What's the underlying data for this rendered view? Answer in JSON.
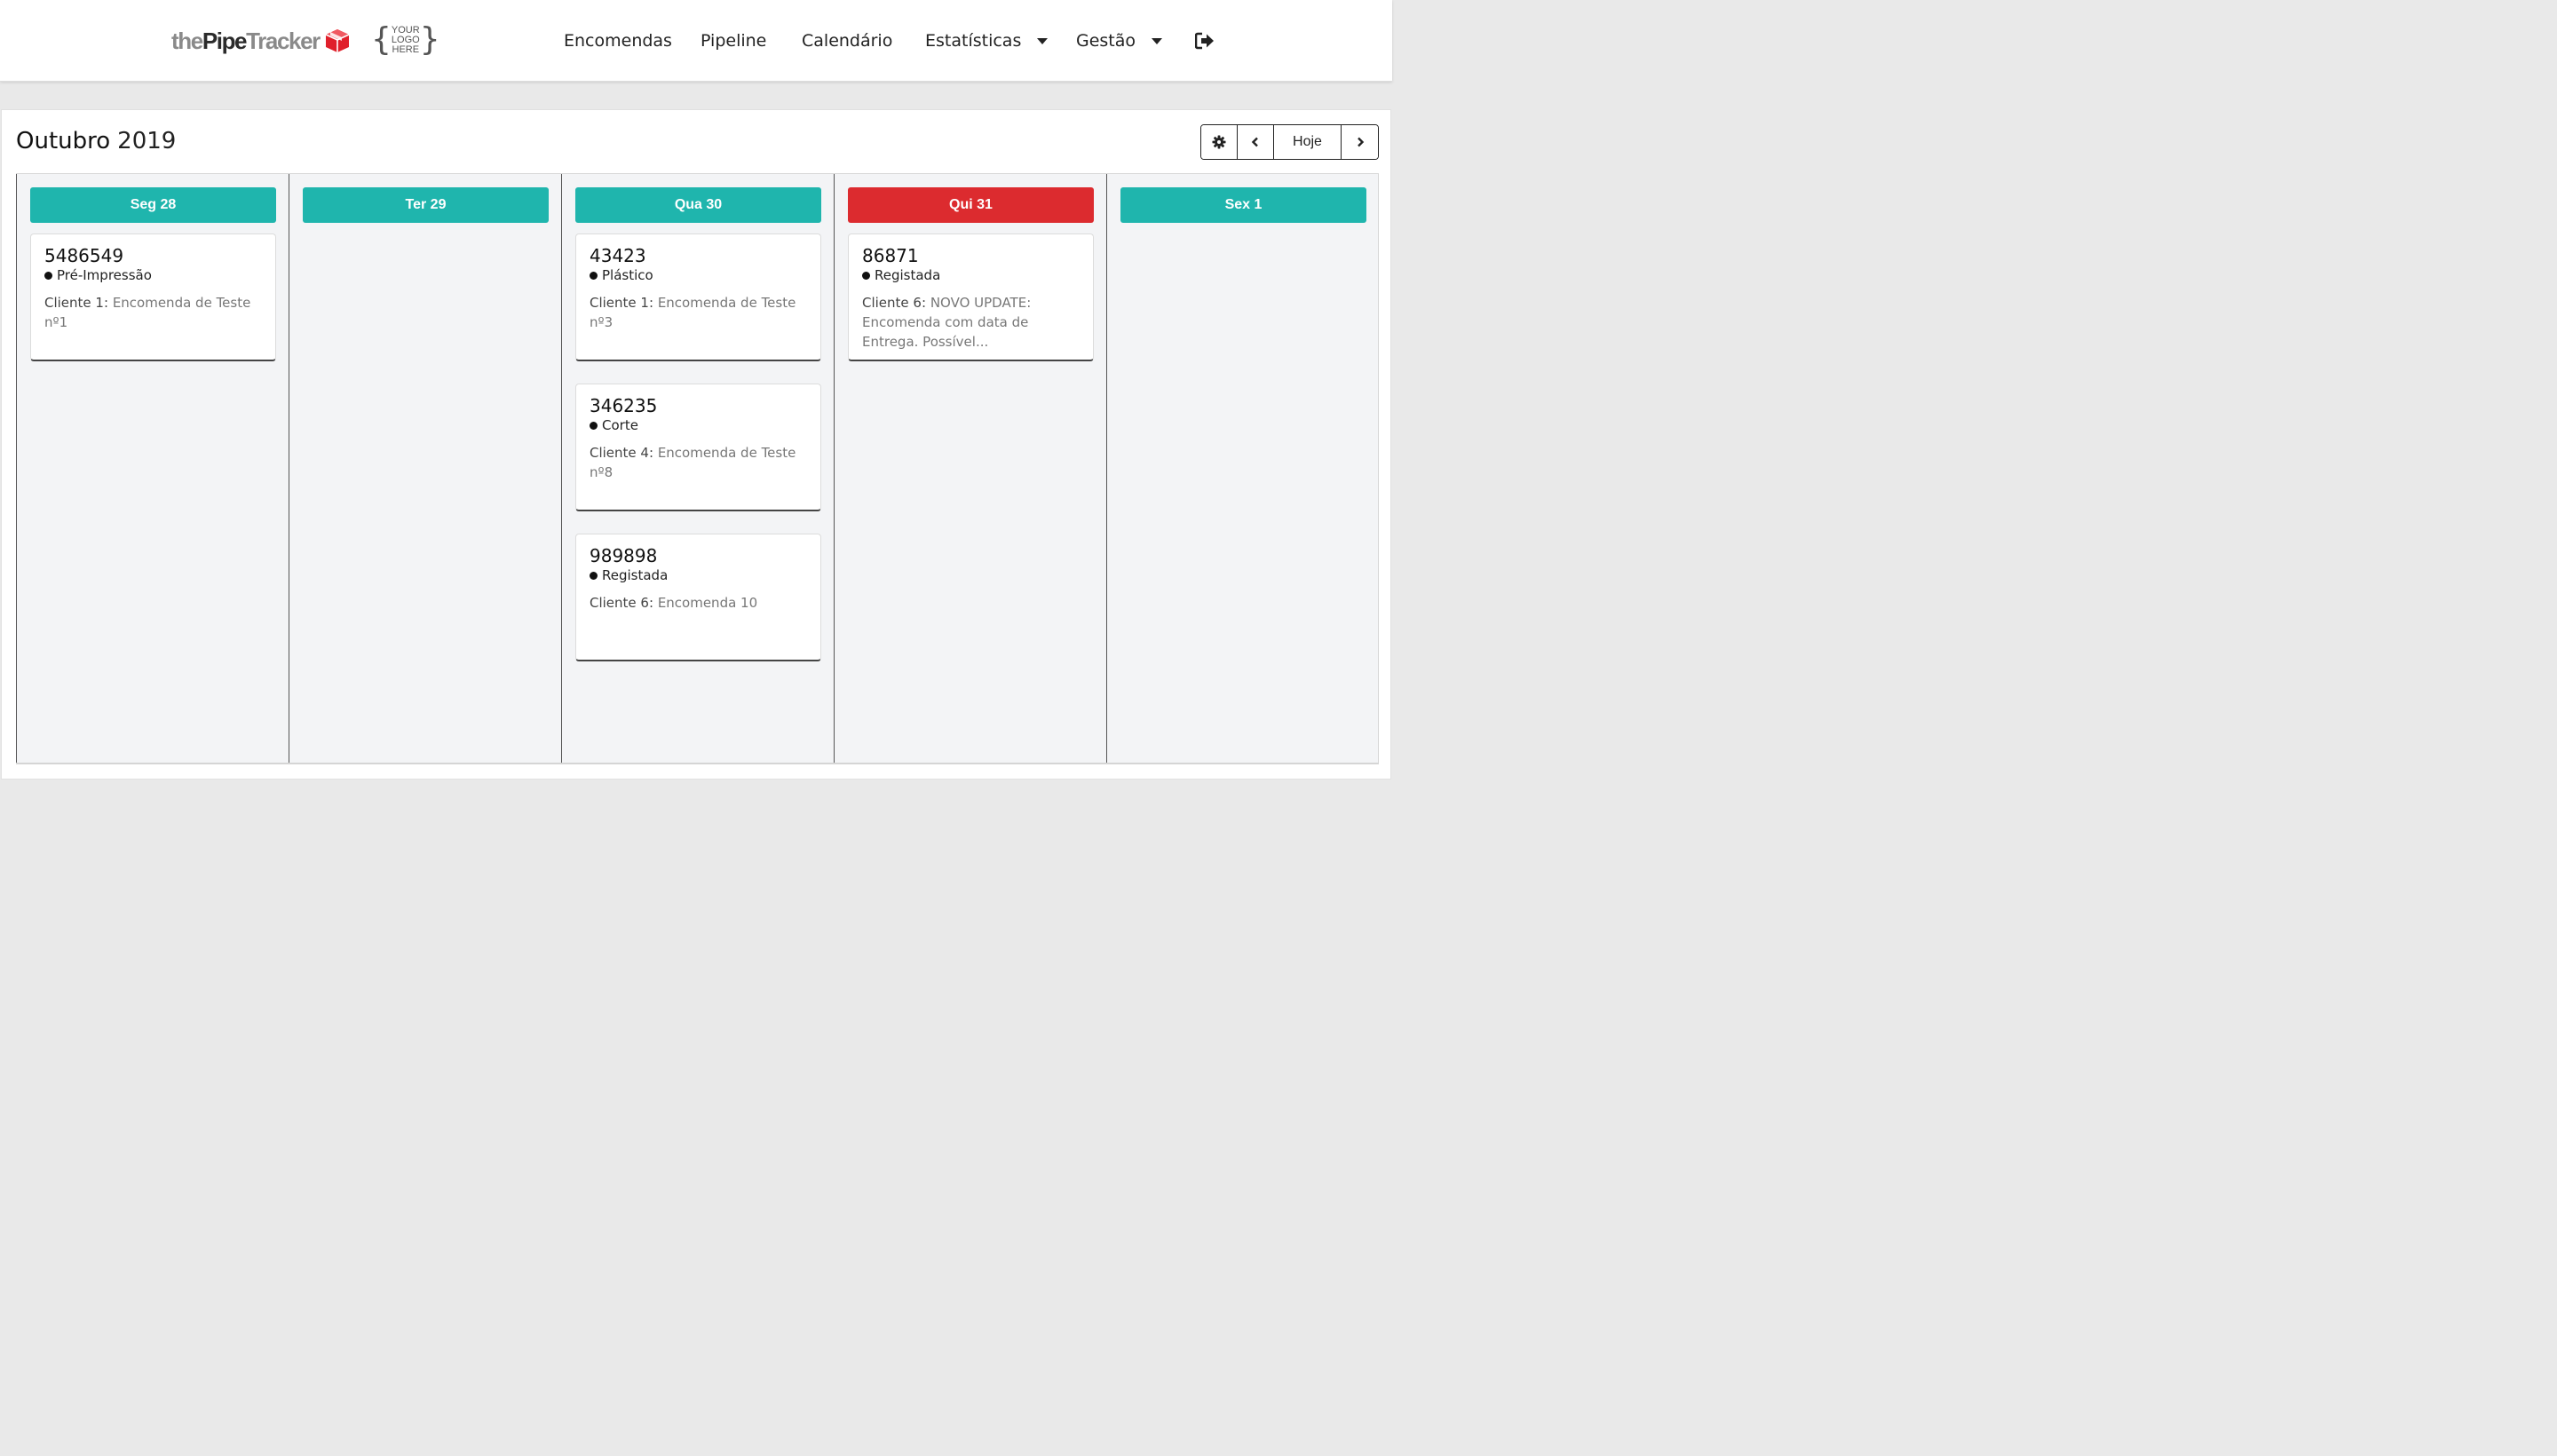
{
  "brand": {
    "part1": "the",
    "part2": "Pipe",
    "part3": "Tracker",
    "logo_lines": [
      "YOUR",
      "LOGO",
      "HERE"
    ]
  },
  "nav": {
    "orders": "Encomendas",
    "pipeline": "Pipeline",
    "calendar": "Calendário",
    "stats": "Estatísticas",
    "management": "Gestão"
  },
  "calendar": {
    "month": "Outubro",
    "year": "2019",
    "today_label": "Hoje",
    "days": [
      {
        "label": "Seg 28",
        "today": false,
        "cards": [
          {
            "number": "5486549",
            "status": "Pré-Impressão",
            "client": "Cliente 1:",
            "description": "Encomenda de Teste nº1"
          }
        ]
      },
      {
        "label": "Ter 29",
        "today": false,
        "cards": []
      },
      {
        "label": "Qua 30",
        "today": false,
        "cards": [
          {
            "number": "43423",
            "status": "Plástico",
            "client": "Cliente 1:",
            "description": "Encomenda de Teste nº3"
          },
          {
            "number": "346235",
            "status": "Corte",
            "client": "Cliente 4:",
            "description": "Encomenda de Teste nº8"
          },
          {
            "number": "989898",
            "status": "Registada",
            "client": "Cliente 6:",
            "description": "Encomenda 10"
          }
        ]
      },
      {
        "label": "Qui 31",
        "today": true,
        "cards": [
          {
            "number": "86871",
            "status": "Registada",
            "client": "Cliente 6:",
            "description": "NOVO UPDATE: Encomenda com data de Entrega. Possível..."
          }
        ]
      },
      {
        "label": "Sex 1",
        "today": false,
        "cards": []
      }
    ]
  },
  "colors": {
    "day_header": "#1fb5ad",
    "today_header": "#dc2b2f",
    "brand_red": "#e0202b"
  },
  "icons": {
    "brand": "box-icon",
    "logout": "sign-out-icon",
    "settings": "gear-icon",
    "prev": "chevron-left-icon",
    "next": "chevron-right-icon"
  }
}
